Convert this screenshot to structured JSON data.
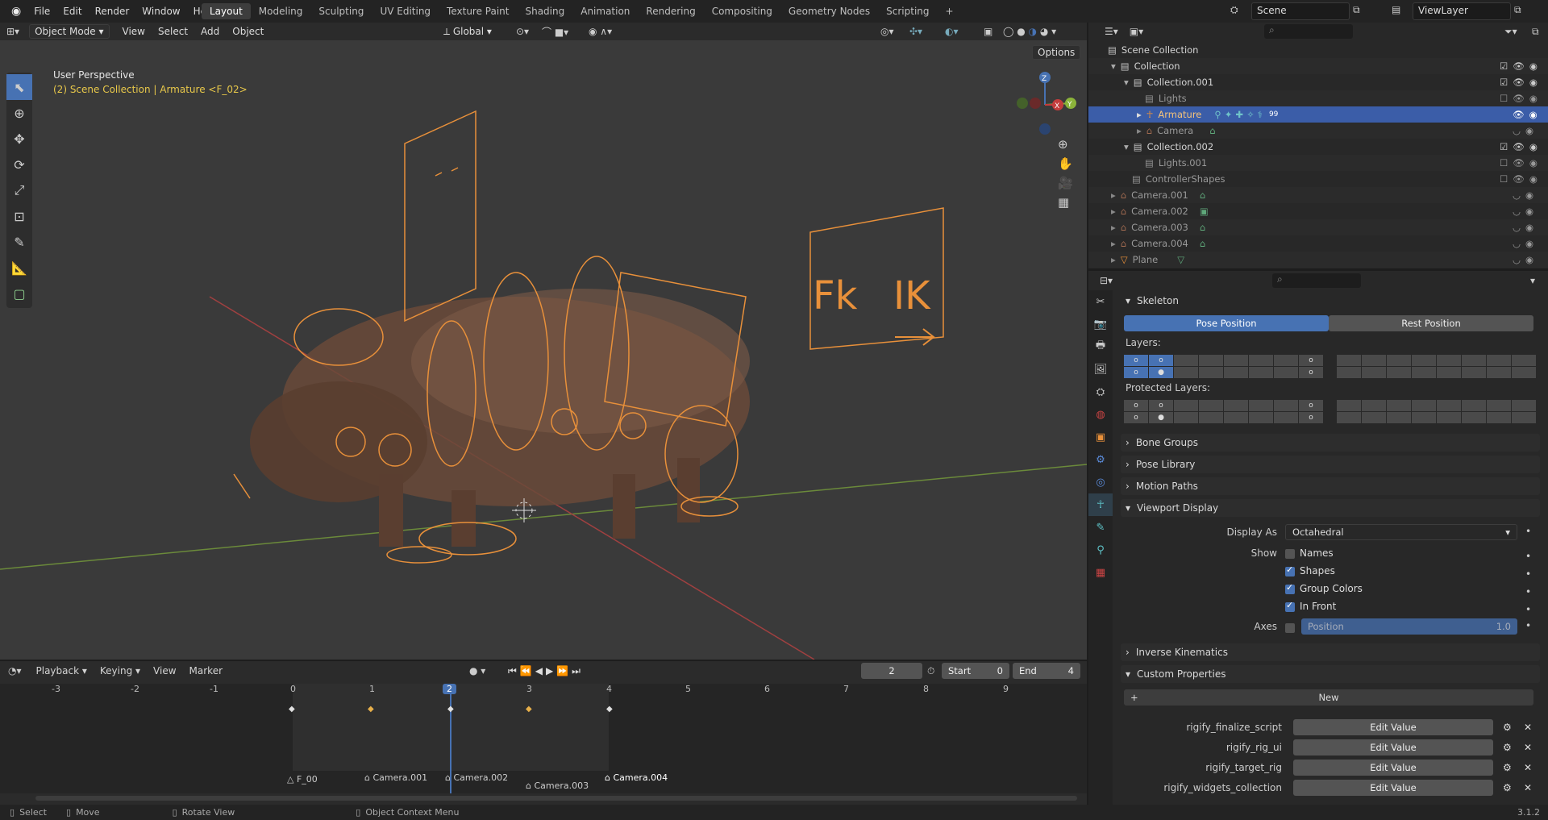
{
  "topbar": {
    "menu": [
      "File",
      "Edit",
      "Render",
      "Window",
      "Help"
    ],
    "workspaces": [
      "Layout",
      "Modeling",
      "Sculpting",
      "UV Editing",
      "Texture Paint",
      "Shading",
      "Animation",
      "Rendering",
      "Compositing",
      "Geometry Nodes",
      "Scripting"
    ],
    "active_workspace": "Layout",
    "add_tab": "+",
    "scene": "Scene",
    "view_layer": "ViewLayer"
  },
  "viewport": {
    "mode": "Object Mode",
    "menus": [
      "View",
      "Select",
      "Add",
      "Object"
    ],
    "orientation": "Global",
    "options": "Options",
    "perspective_label": "User Perspective",
    "context_label": "(2) Scene Collection | Armature <F_02>",
    "sign_fk": "Fk",
    "sign_ik": "IK",
    "gizmo": {
      "z": "Z",
      "y": "Y",
      "x": "X"
    }
  },
  "timeline": {
    "menus": [
      "Playback",
      "Keying",
      "View",
      "Marker"
    ],
    "current_frame": "2",
    "start_label": "Start",
    "start": "0",
    "end_label": "End",
    "end": "4",
    "ruler": [
      "-3",
      "-2",
      "-1",
      "0",
      "1",
      "2",
      "3",
      "4",
      "5",
      "6",
      "7",
      "8",
      "9"
    ],
    "markers": [
      "F_00",
      "Camera.001",
      "Camera.002",
      "Camera.003",
      "Camera.004"
    ]
  },
  "outliner": {
    "rows": [
      {
        "label": "Scene Collection",
        "indent": 0
      },
      {
        "label": "Collection",
        "indent": 1
      },
      {
        "label": "Collection.001",
        "indent": 2
      },
      {
        "label": "Lights",
        "indent": 3
      },
      {
        "label": "Armature",
        "indent": 3
      },
      {
        "label": "Camera",
        "indent": 3
      },
      {
        "label": "Collection.002",
        "indent": 2
      },
      {
        "label": "Lights.001",
        "indent": 3
      },
      {
        "label": "ControllerShapes",
        "indent": 2
      },
      {
        "label": "Camera.001",
        "indent": 1
      },
      {
        "label": "Camera.002",
        "indent": 1
      },
      {
        "label": "Camera.003",
        "indent": 1
      },
      {
        "label": "Camera.004",
        "indent": 1
      },
      {
        "label": "Plane",
        "indent": 1
      }
    ],
    "armature_badge": "99"
  },
  "properties": {
    "skeleton": "Skeleton",
    "pose_position": "Pose Position",
    "rest_position": "Rest Position",
    "layers": "Layers:",
    "protected_layers": "Protected Layers:",
    "bone_groups": "Bone Groups",
    "pose_library": "Pose Library",
    "motion_paths": "Motion Paths",
    "viewport_display": "Viewport Display",
    "display_as_label": "Display As",
    "display_as": "Octahedral",
    "show_label": "Show",
    "names": "Names",
    "shapes": "Shapes",
    "group_colors": "Group Colors",
    "in_front": "In Front",
    "axes_label": "Axes",
    "position_label": "Position",
    "position_value": "1.0",
    "inverse_kinematics": "Inverse Kinematics",
    "custom_properties": "Custom Properties",
    "new": "New",
    "custom": [
      {
        "name": "rigify_finalize_script",
        "value": "Edit Value"
      },
      {
        "name": "rigify_rig_ui",
        "value": "Edit Value"
      },
      {
        "name": "rigify_target_rig",
        "value": "Edit Value"
      },
      {
        "name": "rigify_widgets_collection",
        "value": "Edit Value"
      }
    ]
  },
  "status": {
    "select": "Select",
    "move": "Move",
    "rotate": "Rotate View",
    "context": "Object Context Menu",
    "version": "3.1.2"
  },
  "colors": {
    "accent": "#4772b3",
    "armature": "#e8903a",
    "selected_row": "#3b5da8"
  }
}
